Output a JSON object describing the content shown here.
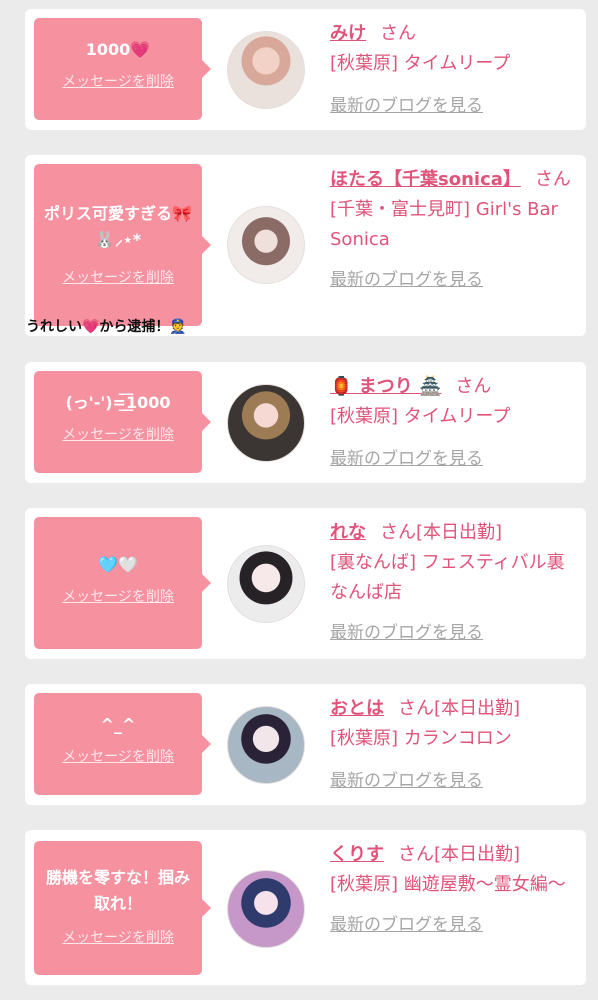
{
  "cards": [
    {
      "message": "1000💗",
      "delete_label": "メッセージを削除",
      "name": "みけ",
      "san": "さん",
      "shop": "[秋葉原] タイムリープ",
      "blog_label": "最新のブログを見る"
    },
    {
      "message": "ポリス可愛すぎる🎀🐰⸝⋆*",
      "delete_label": "メッセージを削除",
      "name": "ほたる【千葉sonica】",
      "san": "さん",
      "shop": "[千葉・富士見町] Girl's Bar Sonica",
      "blog_label": "最新のブログを見る"
    },
    {
      "message": "(っ'-')=͟͟͞͞1000",
      "delete_label": "メッセージを削除",
      "name": "🏮 まつり 🏯",
      "san": "さん",
      "shop": "[秋葉原] タイムリープ",
      "blog_label": "最新のブログを見る"
    },
    {
      "message": "🩵🤍",
      "delete_label": "メッセージを削除",
      "name": "れな",
      "san": "さん[本日出勤]",
      "shop": "[裏なんば] フェスティバル裏なんば店",
      "blog_label": "最新のブログを見る"
    },
    {
      "message": "^_^",
      "delete_label": "メッセージを削除",
      "name": "おとは",
      "san": "さん[本日出勤]",
      "shop": "[秋葉原] カランコロン",
      "blog_label": "最新のブログを見る"
    },
    {
      "message": "勝機を零すな！掴み取れ！",
      "delete_label": "メッセージを削除",
      "name": "くりす",
      "san": "さん[本日出勤]",
      "shop": "[秋葉原] 幽遊屋敷〜霊女編〜",
      "blog_label": "最新のブログを見る"
    }
  ],
  "overlay_note": "うれしい💗から逮捕！👮"
}
